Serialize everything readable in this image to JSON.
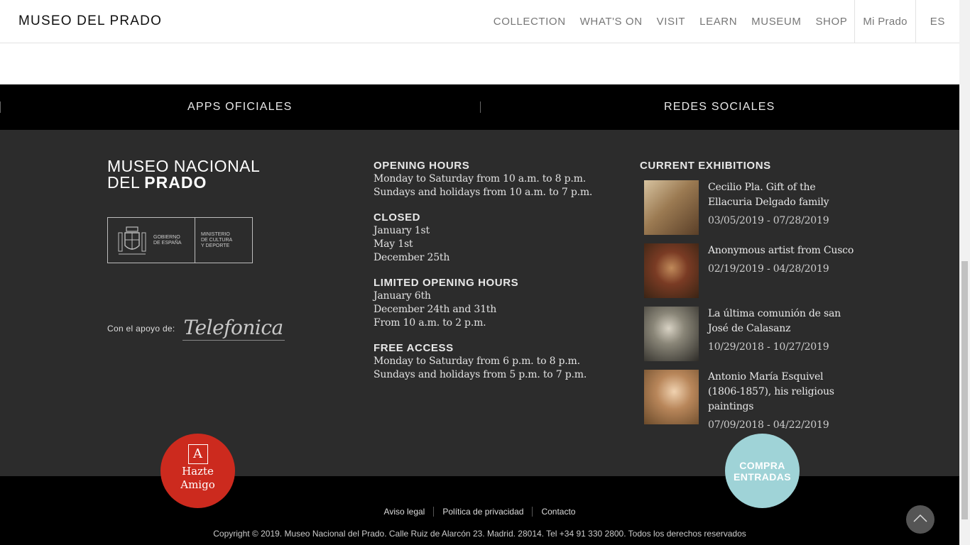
{
  "header": {
    "logo": "MUSEO DEL PRADO",
    "nav": [
      "COLLECTION",
      "WHAT'S ON",
      "VISIT",
      "LEARN",
      "MUSEUM",
      "SHOP"
    ],
    "mi_prado": "Mi Prado",
    "lang": "ES"
  },
  "apps_bar": {
    "left": "APPS OFICIALES",
    "right": "REDES SOCIALES"
  },
  "brand": {
    "line1": "MUSEO NACIONAL",
    "line2a": "DEL",
    "line2b": "PRADO"
  },
  "gov": {
    "gobierno": "GOBIERNO\nDE ESPAÑA",
    "ministerio": "MINISTERIO\nDE CULTURA\nY DEPORTE"
  },
  "sponsor": {
    "label": "Con el apoyo de:",
    "name": "Telefonica"
  },
  "hours": {
    "opening_title": "OPENING HOURS",
    "opening_lines": [
      "Monday to Saturday from 10 a.m. to 8 p.m.",
      "Sundays and holidays from 10 a.m. to 7 p.m."
    ],
    "closed_title": "CLOSED",
    "closed_lines": [
      "January 1st",
      "May 1st",
      "December 25th"
    ],
    "limited_title": "LIMITED OPENING HOURS",
    "limited_lines": [
      "January 6th",
      "December 24th and 31th",
      "From 10 a.m. to 2 p.m."
    ],
    "free_title": "FREE ACCESS",
    "free_lines": [
      "Monday to Saturday from 6 p.m. to 8 p.m.",
      "Sundays and holidays from 5 p.m. to 7 p.m."
    ]
  },
  "exhibitions": {
    "title": "CURRENT EXHIBITIONS",
    "items": [
      {
        "title": "Cecilio Pla. Gift of the Ellacuria Delgado family",
        "dates": "03/05/2019 - 07/28/2019",
        "color": "#9b7a52"
      },
      {
        "title": "Anonymous artist from Cusco",
        "dates": "02/19/2019 - 04/28/2019",
        "color": "#7a3b24"
      },
      {
        "title": "La última comunión de san José de Calasanz",
        "dates": "10/29/2018 - 10/27/2019",
        "color": "#7a7a70"
      },
      {
        "title": "Antonio María Esquivel (1806-1857), his religious paintings",
        "dates": "07/09/2018 - 04/22/2019",
        "color": "#b8865a"
      }
    ]
  },
  "buttons": {
    "amigo_icon": "A",
    "amigo_line1": "Hazte",
    "amigo_line2": "Amigo",
    "compra_line1": "COMPRA",
    "compra_line2": "ENTRADAS"
  },
  "bottom": {
    "links": [
      "Aviso legal",
      "Política de privacidad",
      "Contacto"
    ],
    "copyright": "Copyright © 2019. Museo Nacional del Prado. Calle Ruiz de Alarcón 23. Madrid. 28014. Tel +34 91 330 2800. Todos los derechos reservados"
  },
  "colors": {
    "footer_bg": "#2c2c2c",
    "amigo": "#cc2a1e",
    "compra": "#9fd3d7"
  }
}
